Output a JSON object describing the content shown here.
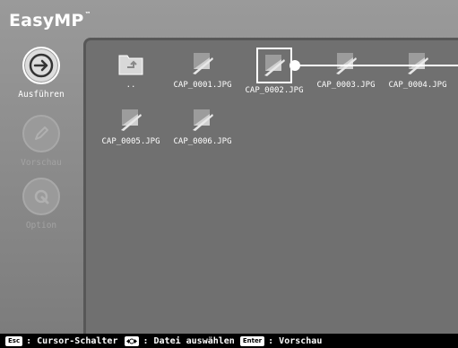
{
  "app": {
    "logo_text": "EasyMP",
    "logo_mark": "™"
  },
  "sidebar": {
    "items": [
      {
        "label": "Ausführen",
        "icon": "arrow-right-icon",
        "state": "active"
      },
      {
        "label": "Vorschau",
        "icon": "pencil-icon",
        "state": "disabled"
      },
      {
        "label": "Option",
        "icon": "wrench-icon",
        "state": "disabled"
      }
    ]
  },
  "files": [
    {
      "name": "..",
      "type": "parent-folder"
    },
    {
      "name": "CAP_0001.JPG",
      "type": "image"
    },
    {
      "name": "CAP_0002.JPG",
      "type": "image",
      "selected": true
    },
    {
      "name": "CAP_0003.JPG",
      "type": "image"
    },
    {
      "name": "CAP_0004.JPG",
      "type": "image"
    },
    {
      "name": "CAP_0005.JPG",
      "type": "image"
    },
    {
      "name": "CAP_0006.JPG",
      "type": "image"
    }
  ],
  "statusbar": {
    "esc_key": "Esc",
    "esc_text": ": Cursor-Schalter",
    "arrows_text": ": Datei auswählen",
    "enter_key": "Enter",
    "enter_text": ": Vorschau"
  }
}
